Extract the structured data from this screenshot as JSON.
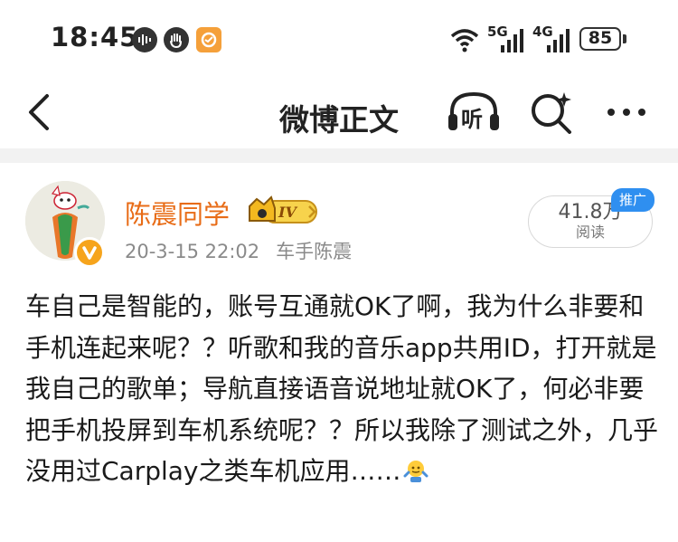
{
  "status_bar": {
    "time": "18:45",
    "network_1": "5G",
    "network_2": "4G",
    "battery": "85"
  },
  "nav": {
    "title": "微博正文",
    "listen_label": "听"
  },
  "post": {
    "username": "陈震同学",
    "vip_level": "IV",
    "date": "20-3-15 22:02",
    "source": "车手陈震",
    "reads_count": "41.8万",
    "reads_label": "阅读",
    "promo_tag": "推广",
    "text": "车自己是智能的，账号互通就OK了啊，我为什么非要和手机连起来呢？？听歌和我的音乐app共用ID，打开就是我自己的歌单；导航直接语音说地址就OK了，何必非要把手机投屏到车机系统呢？？所以我除了测试之外，几乎没用过Carplay之类车机应用……"
  },
  "colors": {
    "username": "#e86c17",
    "promo": "#2f8ff0",
    "verified": "#f6a41c"
  }
}
